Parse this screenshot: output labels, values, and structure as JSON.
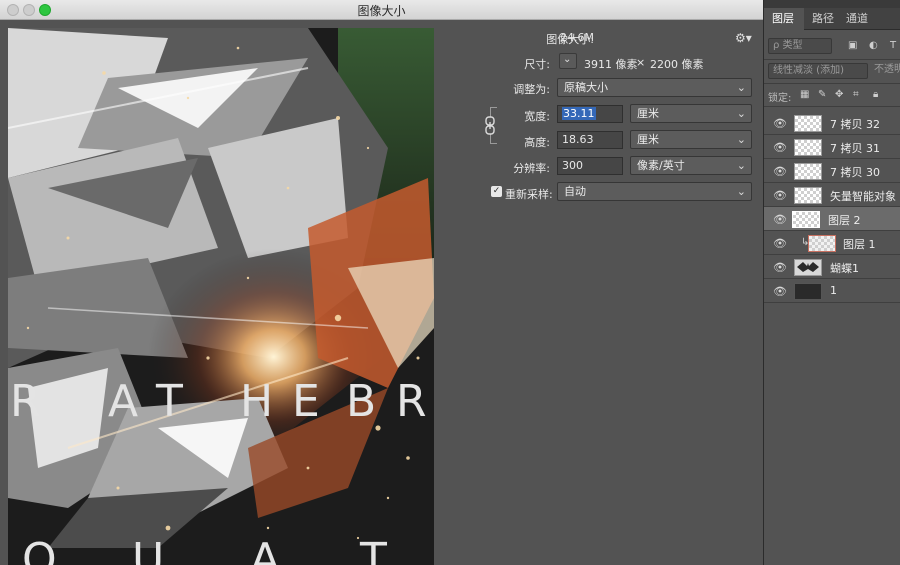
{
  "window": {
    "title": "图像大小"
  },
  "form": {
    "image_size": {
      "label": "图像大小:",
      "value": "24.6M"
    },
    "dimensions": {
      "label": "尺寸:",
      "width": "3911 像素",
      "times": "×",
      "height": "2200 像素"
    },
    "fit_to": {
      "label": "调整为:",
      "value": "原稿大小"
    },
    "width": {
      "label": "宽度:",
      "value": "33.11",
      "unit": "厘米"
    },
    "height": {
      "label": "高度:",
      "value": "18.63",
      "unit": "厘米"
    },
    "resolution": {
      "label": "分辨率:",
      "value": "300",
      "unit": "像素/英寸"
    },
    "resample": {
      "label": "重新采样:",
      "checked": true,
      "value": "自动"
    }
  },
  "preview": {
    "row1_letters": [
      "R",
      "A",
      "T",
      "H",
      "E",
      "B",
      "R"
    ],
    "row2_letters": [
      "Q",
      "U",
      "A",
      "T"
    ]
  },
  "panel": {
    "tabs": [
      "图层",
      "路径",
      "通道"
    ],
    "filter_kind": "ρ 类型",
    "blend_mode": "线性减淡 (添加)",
    "opacity_label": "不透明",
    "lock_label": "锁定:",
    "layers": [
      {
        "name": "7 拷贝 32",
        "selected": false,
        "clipped": false
      },
      {
        "name": "7 拷贝 31",
        "selected": false,
        "clipped": false
      },
      {
        "name": "7 拷贝 30",
        "selected": false,
        "clipped": false
      },
      {
        "name": "矢量智能对象",
        "selected": false,
        "clipped": false
      },
      {
        "name": "图层 2",
        "selected": true,
        "clipped": false
      },
      {
        "name": "图层 1",
        "selected": false,
        "clipped": true
      },
      {
        "name": "蝴蝶1",
        "selected": false,
        "clipped": false
      },
      {
        "name": "1",
        "selected": false,
        "clipped": false
      }
    ]
  },
  "colors": {
    "accent": "#3468b8",
    "zoom_button": "#2dc640",
    "background": "#535353"
  }
}
